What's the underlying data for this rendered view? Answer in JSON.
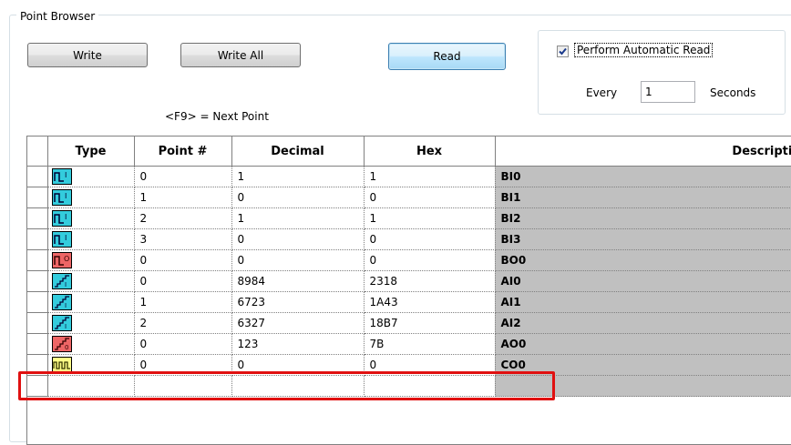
{
  "group_title": "Point Browser",
  "buttons": {
    "write": "Write",
    "write_all": "Write All",
    "read": "Read"
  },
  "hint": "<F9> = Next Point",
  "auto_read": {
    "label": "Perform Automatic Read",
    "checked": true,
    "every_label": "Every",
    "interval": "1",
    "seconds_label": "Seconds"
  },
  "table": {
    "columns": [
      "Type",
      "Point #",
      "Decimal",
      "Hex",
      "Description"
    ],
    "rows": [
      {
        "type_icon": "binary-input-icon",
        "point": "0",
        "decimal": "1",
        "hex": "1",
        "description": "BI0"
      },
      {
        "type_icon": "binary-input-icon",
        "point": "1",
        "decimal": "0",
        "hex": "0",
        "description": "BI1"
      },
      {
        "type_icon": "binary-input-icon",
        "point": "2",
        "decimal": "1",
        "hex": "1",
        "description": "BI2"
      },
      {
        "type_icon": "binary-input-icon",
        "point": "3",
        "decimal": "0",
        "hex": "0",
        "description": "BI3"
      },
      {
        "type_icon": "binary-output-icon",
        "point": "0",
        "decimal": "0",
        "hex": "0",
        "description": "BO0"
      },
      {
        "type_icon": "analog-input-icon",
        "point": "0",
        "decimal": "8984",
        "hex": "2318",
        "description": "AI0"
      },
      {
        "type_icon": "analog-input-icon",
        "point": "1",
        "decimal": "6723",
        "hex": "1A43",
        "description": "AI1"
      },
      {
        "type_icon": "analog-input-icon",
        "point": "2",
        "decimal": "6327",
        "hex": "18B7",
        "description": "AI2"
      },
      {
        "type_icon": "analog-output-icon",
        "point": "0",
        "decimal": "123",
        "hex": "7B",
        "description": "AO0"
      },
      {
        "type_icon": "counter-icon",
        "point": "0",
        "decimal": "0",
        "hex": "0",
        "description": "CO0"
      },
      {
        "type_icon": "",
        "point": "",
        "decimal": "",
        "hex": "",
        "description": ""
      }
    ]
  },
  "colors": {
    "input_icon_bg": "#33ccdd",
    "output_icon_bg": "#ee6666",
    "counter_icon_bg": "#ffff88",
    "description_bg": "#c0c0c0",
    "highlight": "#e01010"
  }
}
